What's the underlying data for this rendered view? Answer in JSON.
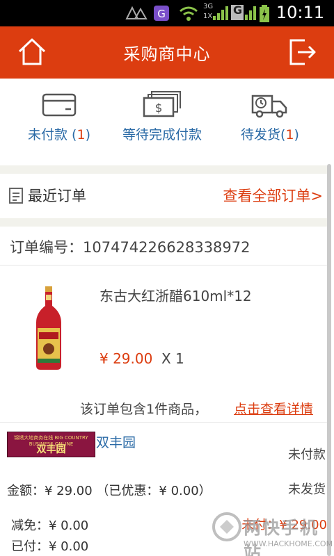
{
  "status_bar": {
    "time": "10:11",
    "network_label": "3G",
    "signal_label": "1X",
    "g_label": "G"
  },
  "header": {
    "title": "采购商中心",
    "home_icon": "home-icon",
    "logout_icon": "logout-icon"
  },
  "status_items": [
    {
      "label": "未付款",
      "count": "1",
      "icon": "card-icon"
    },
    {
      "label": "等待完成付款",
      "count": "",
      "icon": "cash-icon"
    },
    {
      "label": "待发货",
      "count": "1",
      "icon": "truck-icon"
    }
  ],
  "recent": {
    "title": "最近订单",
    "view_all": "查看全部订单>"
  },
  "order": {
    "number_label": "订单编号：107474226628338972",
    "product_name": "东古大红浙醋610ml*12",
    "price": "¥ 29.00",
    "quantity": "X 1",
    "summary_text": "该订单包含1件商品，",
    "details_link": "点击查看详情"
  },
  "shop": {
    "logo_line1": "锦绣大地商务在线 BIG COUNTRY BUSINESS ONLINE",
    "logo_line2": "双丰园",
    "name": "双丰园",
    "payment_status": "未付款",
    "amount_text": "金额：¥ 29.00 （已优惠：¥ 0.00）",
    "ship_status": "未发货",
    "reduction_text": "减免：¥ 0.00",
    "paid_text": "已付：¥ 0.00",
    "unpaid_text": "未付：¥ 29.00"
  },
  "watermark": {
    "text": "两快手机站",
    "url": "WWW.HACKHOME.COM"
  },
  "colors": {
    "brand": "#dc3d10",
    "link": "#2a6aa6"
  }
}
